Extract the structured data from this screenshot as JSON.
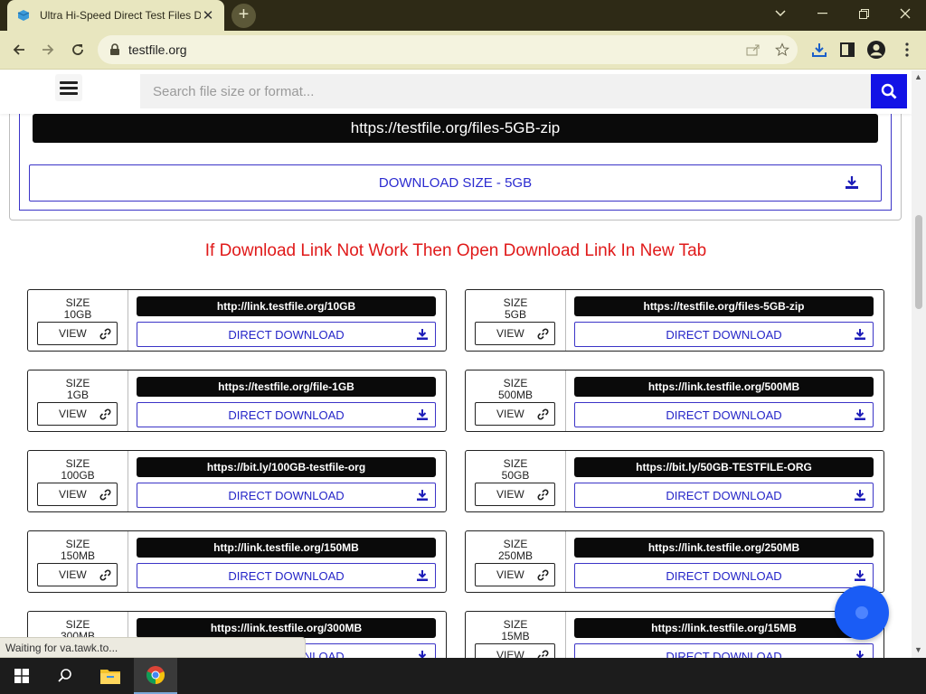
{
  "browser": {
    "tab_title": "Ultra Hi-Speed Direct Test Files D",
    "new_tab_symbol": "+",
    "url": "testfile.org",
    "status_text": "Waiting for va.tawk.to..."
  },
  "header": {
    "search_placeholder": "Search file size or format..."
  },
  "featured": {
    "link": "https://testfile.org/files-5GB-zip",
    "button_label": "DOWNLOAD SIZE - 5GB"
  },
  "notice": "If Download Link Not Work Then Open Download Link In New Tab",
  "labels": {
    "size": "SIZE",
    "view": "VIEW",
    "direct_download": "DIRECT DOWNLOAD"
  },
  "files": [
    {
      "size": "10GB",
      "link": "http://link.testfile.org/10GB"
    },
    {
      "size": "5GB",
      "link": "https://testfile.org/files-5GB-zip"
    },
    {
      "size": "1GB",
      "link": "https://testfile.org/file-1GB"
    },
    {
      "size": "500MB",
      "link": "https://link.testfile.org/500MB"
    },
    {
      "size": "100GB",
      "link": "https://bit.ly/100GB-testfile-org"
    },
    {
      "size": "50GB",
      "link": "https://bit.ly/50GB-TESTFILE-ORG"
    },
    {
      "size": "150MB",
      "link": "http://link.testfile.org/150MB"
    },
    {
      "size": "250MB",
      "link": "https://link.testfile.org/250MB"
    },
    {
      "size": "300MB",
      "link": "https://link.testfile.org/300MB"
    },
    {
      "size": "15MB",
      "link": "https://link.testfile.org/15MB"
    }
  ],
  "colors": {
    "accent": "#1212e6",
    "button_text": "#2525c8",
    "notice": "#e01a1a",
    "chrome": "#e8e6bf",
    "tabbar": "#2e2a16"
  }
}
